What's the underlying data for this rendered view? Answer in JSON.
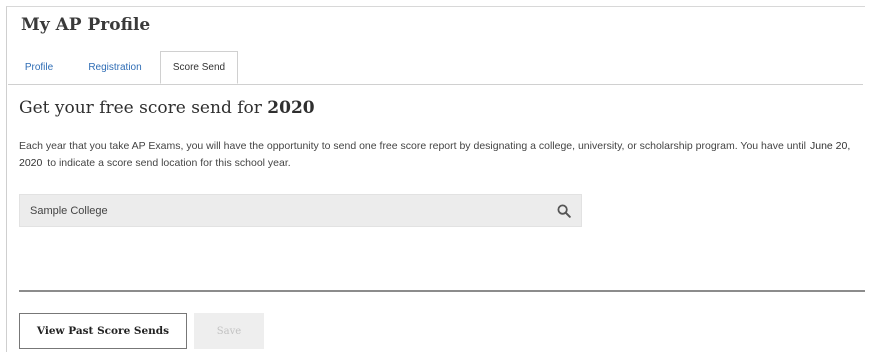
{
  "page": {
    "title": "My AP Profile"
  },
  "tabs": [
    {
      "label": "Profile"
    },
    {
      "label": "Registration"
    },
    {
      "label": "Score Send",
      "active": true
    }
  ],
  "score_send": {
    "heading_prefix": "Get your free score send for",
    "heading_year": "2020",
    "description_part1": "Each year that you take AP Exams, you will have the opportunity to send one free score report by designating a college, university, or scholarship program. You have until",
    "deadline": "June 20, 2020",
    "description_part2": "to indicate a score send location for this school year.",
    "search": {
      "value": "Sample College",
      "icon": "search-icon"
    }
  },
  "actions": {
    "view_past_label": "View Past Score Sends",
    "save_label": "Save",
    "save_disabled": true
  },
  "colors": {
    "link": "#2f6db5",
    "search_bg": "#ececec",
    "divider": "#8c8c8c"
  }
}
